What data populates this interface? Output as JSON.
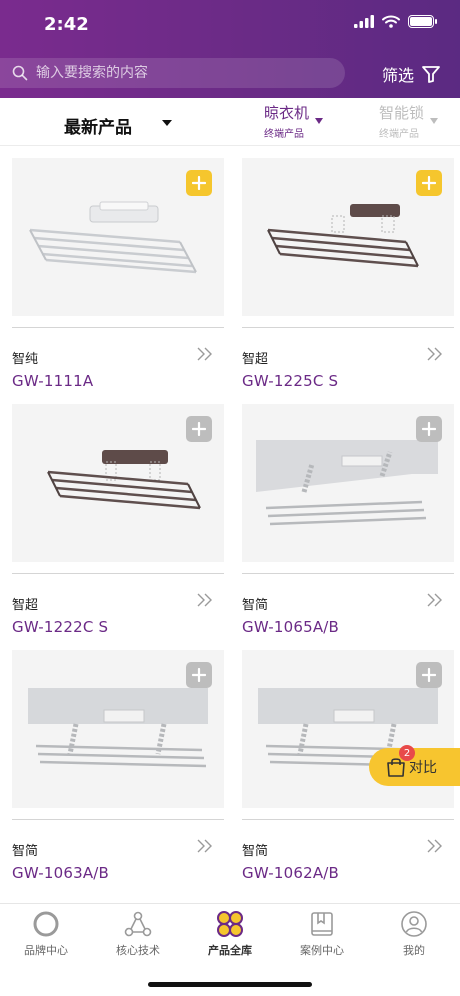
{
  "status": {
    "time": "2:42"
  },
  "search": {
    "placeholder": "输入要搜索的内容"
  },
  "filter": {
    "label": "筛选"
  },
  "categories": {
    "latest": "最新产品",
    "items": [
      {
        "label": "晾衣机",
        "sub": "终端产品",
        "active": true
      },
      {
        "label": "智能锁",
        "sub": "终端产品",
        "active": false
      }
    ]
  },
  "products": [
    {
      "series": "智纯",
      "model": "GW-1111A",
      "added": true
    },
    {
      "series": "智超",
      "model": "GW-1225C S",
      "added": true
    },
    {
      "series": "智超",
      "model": "GW-1222C S",
      "added": false
    },
    {
      "series": "智简",
      "model": "GW-1065A/B",
      "added": false
    },
    {
      "series": "智简",
      "model": "GW-1063A/B",
      "added": false
    },
    {
      "series": "智简",
      "model": "GW-1062A/B",
      "added": false
    }
  ],
  "compare": {
    "label": "对比",
    "count": "2"
  },
  "tabs": [
    {
      "label": "品牌中心",
      "icon": "circle-icon"
    },
    {
      "label": "核心技术",
      "icon": "network-icon"
    },
    {
      "label": "产品全库",
      "icon": "petals-icon",
      "active": true
    },
    {
      "label": "案例中心",
      "icon": "book-icon"
    },
    {
      "label": "我的",
      "icon": "user-icon"
    }
  ],
  "colors": {
    "brand": "#6b2a86",
    "accent": "#f5c62d",
    "badge": "#e84a4a"
  }
}
